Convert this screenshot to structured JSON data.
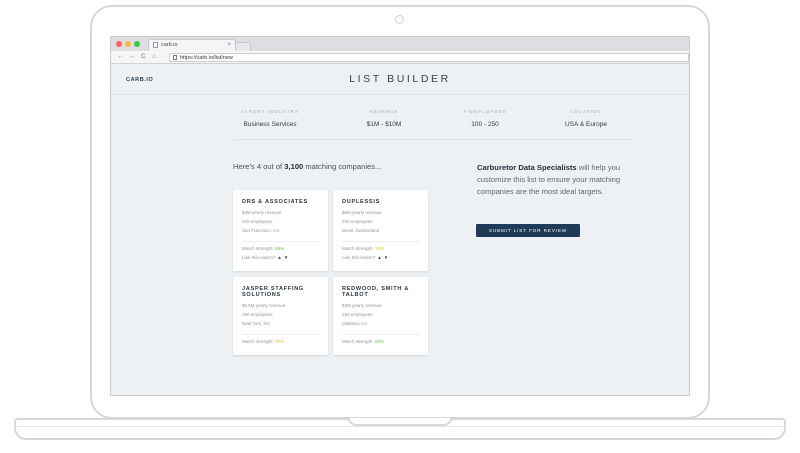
{
  "browser": {
    "tab_title": "carb.io",
    "tab_close": "×",
    "back": "←",
    "forward": "→",
    "reload": "C",
    "home": "⌂",
    "url": "https://carb.io/list/new"
  },
  "header": {
    "logo": "CARB.IO",
    "title": "LIST BUILDER"
  },
  "criteria": [
    {
      "label": "TARGET INDUSTRY",
      "value": "Business Services"
    },
    {
      "label": "REVENUE",
      "value": "$1M - $10M"
    },
    {
      "label": "# EMPLOYEES",
      "value": "100 - 250"
    },
    {
      "label": "LOCATION",
      "value": "USA & Europe"
    }
  ],
  "summary": {
    "prefix": "Here's 4 out of ",
    "count": "3,100",
    "suffix": " matching companies..."
  },
  "companies": [
    {
      "name": "DRS & ASSOCIATES",
      "revenue": "$4M yearly revenue",
      "employees": "200 employees",
      "location": "San Francisco, CA",
      "match_label": "Match strength: ",
      "match": "85%",
      "match_color": "#6cc04a",
      "like_label": "Like this match?"
    },
    {
      "name": "DUPLESSIS",
      "revenue": "$6M yearly revenue",
      "employees": "230 employees",
      "location": "Basel, Switzerland",
      "match_label": "Match strength: ",
      "match": "75%",
      "match_color": "#e8c21a",
      "like_label": "Like this match?"
    },
    {
      "name": "JASPER STAFFING SOLUTIONS",
      "revenue": "$5.5M yearly revenue",
      "employees": "160 employees",
      "location": "New York, NY",
      "match_label": "Match strength: ",
      "match": "70%",
      "match_color": "#e8c21a"
    },
    {
      "name": "REDWOOD, SMITH & TALBOT",
      "revenue": "$3M yearly revenue",
      "employees": "150 employees",
      "location": "Oakland, CA",
      "match_label": "Match strength: ",
      "match": "80%",
      "match_color": "#6cc04a"
    }
  ],
  "pitch": {
    "brand": "Carburetor Data Specialists",
    "text": " will help you customize this list to ensure your matching companies are the most ideal targets."
  },
  "submit_label": "SUBMIT LIST FOR REVIEW",
  "colors": {
    "accent": "#1f3b57",
    "match_high": "#6cc04a",
    "match_mid": "#e8c21a"
  },
  "icons": {
    "like": "thumbs-up-icon",
    "dislike": "thumbs-down-icon"
  }
}
